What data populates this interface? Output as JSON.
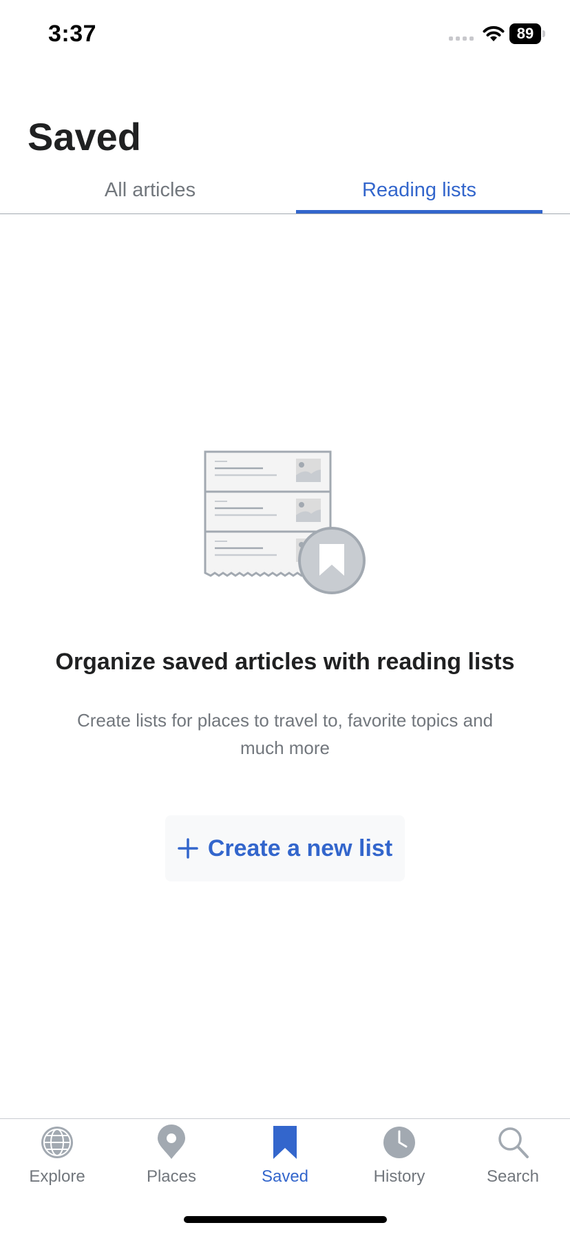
{
  "status_bar": {
    "time": "3:37",
    "battery": "89"
  },
  "header": {
    "title": "Saved"
  },
  "tabs": [
    {
      "label": "All articles",
      "active": false
    },
    {
      "label": "Reading lists",
      "active": true
    }
  ],
  "empty_state": {
    "illustration": "reading-list-bookmark-illustration",
    "title": "Organize saved articles with reading lists",
    "subtitle": "Create lists for places to travel to, favorite topics and much more",
    "button_label": "Create a new list",
    "button_icon": "plus-icon"
  },
  "tab_bar": {
    "items": [
      {
        "label": "Explore",
        "icon": "globe-icon",
        "active": false
      },
      {
        "label": "Places",
        "icon": "map-pin-icon",
        "active": false
      },
      {
        "label": "Saved",
        "icon": "bookmark-icon",
        "active": true
      },
      {
        "label": "History",
        "icon": "clock-icon",
        "active": false
      },
      {
        "label": "Search",
        "icon": "search-icon",
        "active": false
      }
    ]
  },
  "colors": {
    "accent": "#3366cc",
    "inactive": "#72777d",
    "text": "#202122",
    "icon_gray": "#a2a9b1"
  }
}
